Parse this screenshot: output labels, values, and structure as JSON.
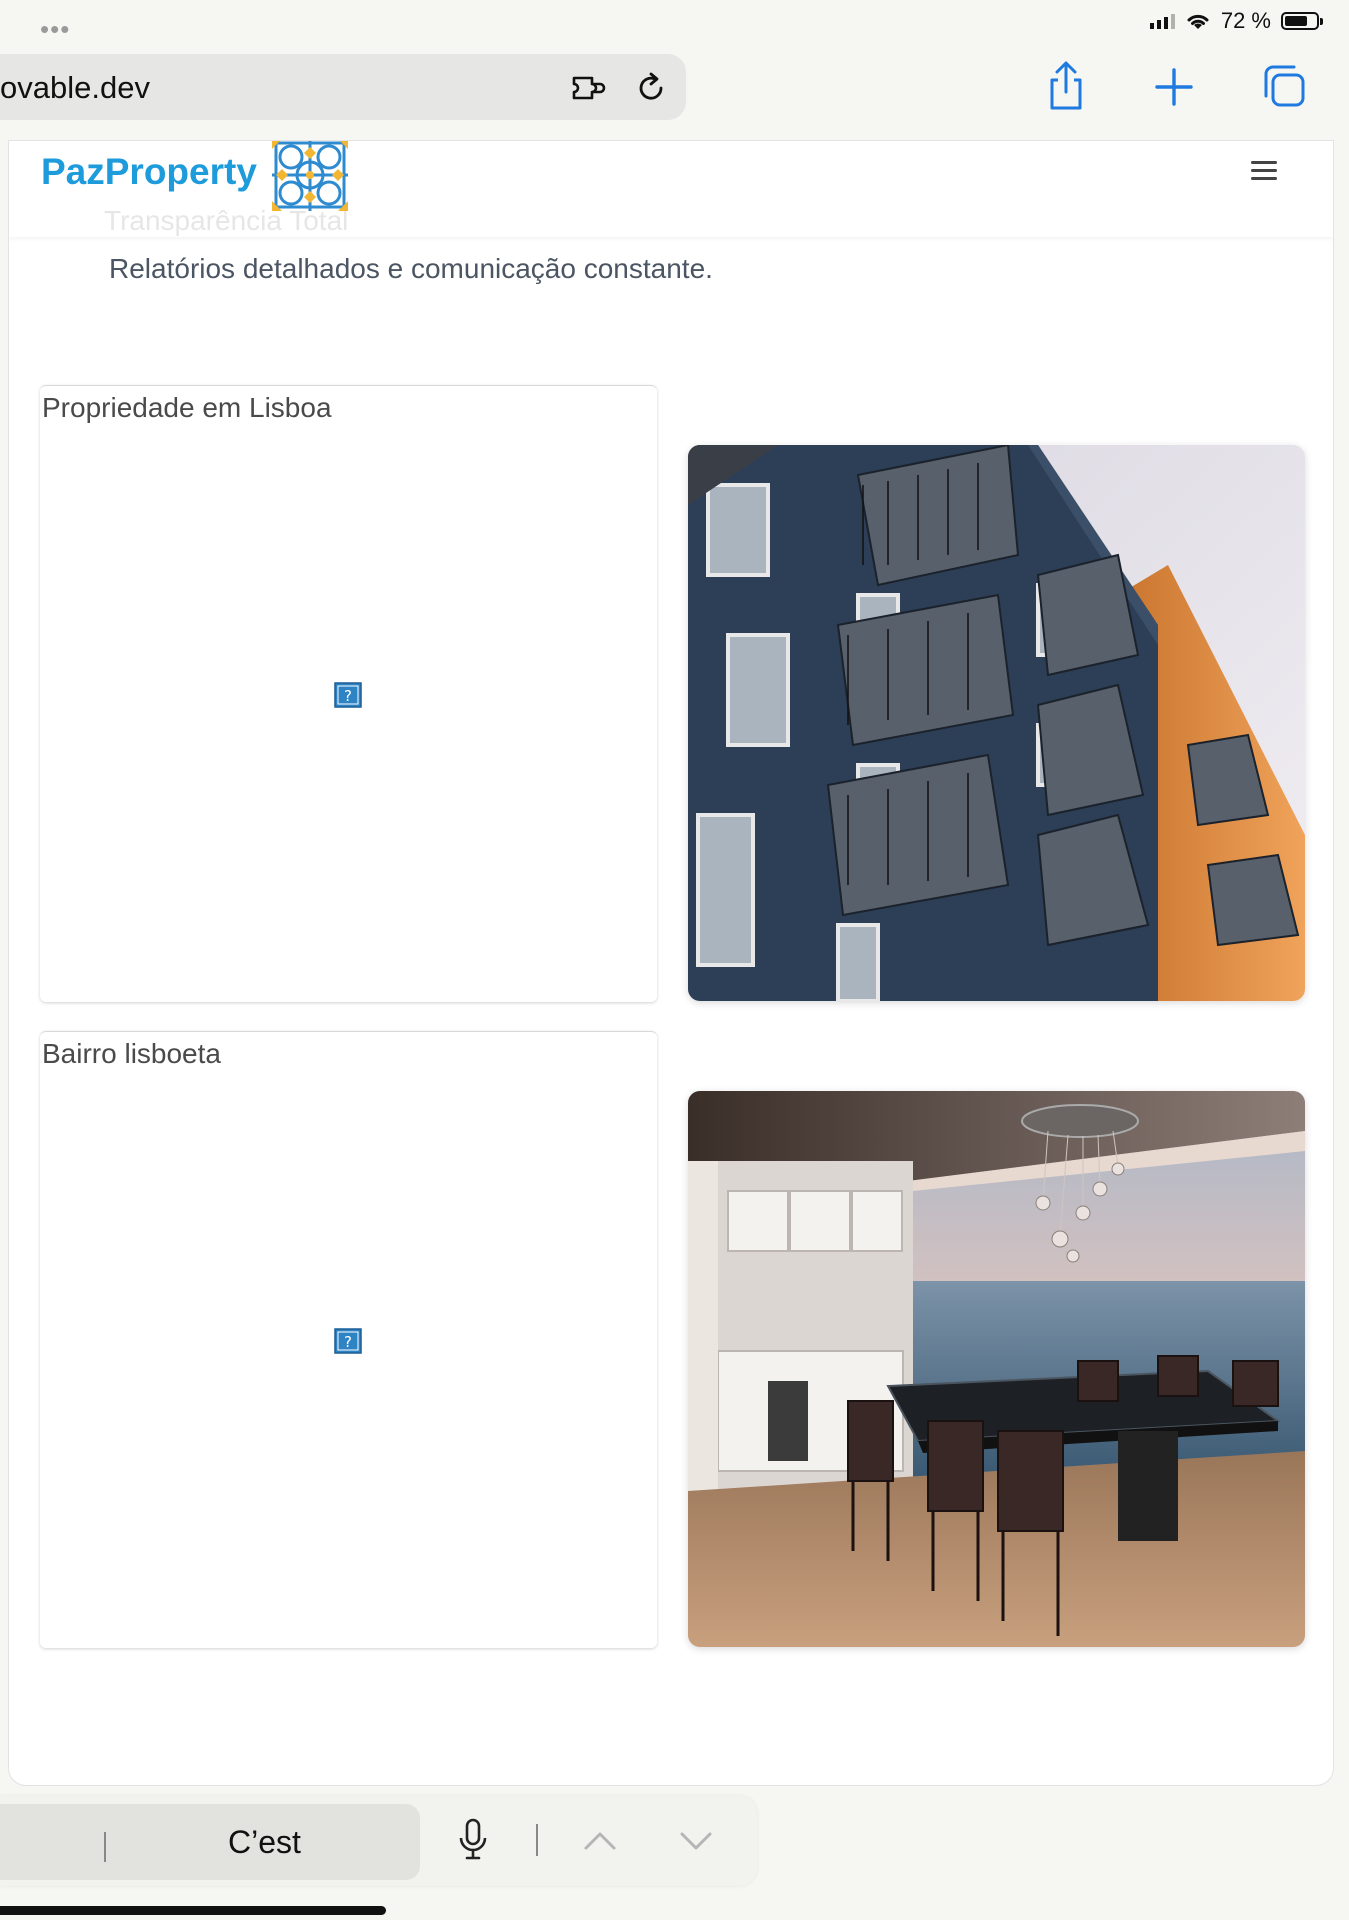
{
  "status": {
    "battery": "72 %",
    "battery_fraction": 0.72
  },
  "browser": {
    "url": "ovable.dev"
  },
  "site": {
    "logo_text": "PazProperty",
    "ghost_text": "Transparência Total",
    "intro_text": "Relatórios detalhados e comunicação constante."
  },
  "gallery": [
    {
      "caption": "Propriedade em Lisboa"
    },
    {
      "caption": "Bairro lisboeta"
    }
  ],
  "findbar": {
    "text": "C’est"
  },
  "colors": {
    "brand": "#1d9bdb",
    "tile_blue": "#2e8bd0",
    "tile_yellow": "#f2b632"
  }
}
